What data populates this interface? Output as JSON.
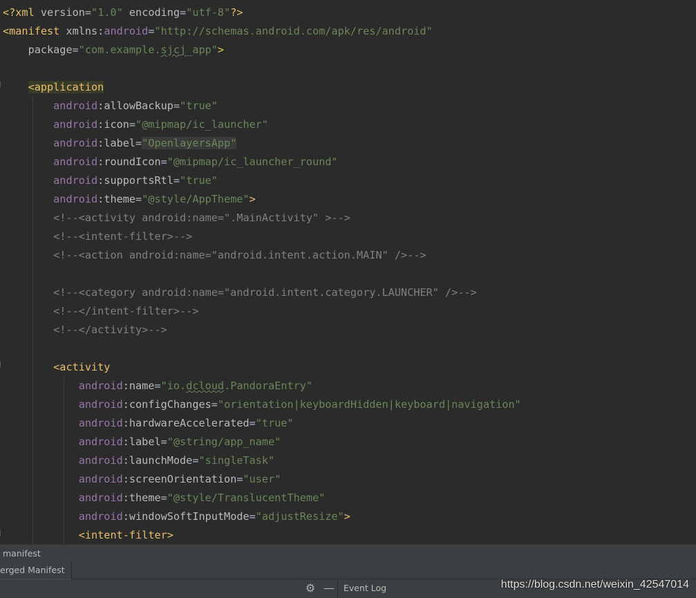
{
  "editor": {
    "lines": [
      [
        [
          "tag",
          "<?xml "
        ],
        [
          "attr",
          "version"
        ],
        [
          "plain",
          "="
        ],
        [
          "str",
          "\"1.0\""
        ],
        [
          "attr",
          " encoding"
        ],
        [
          "plain",
          "="
        ],
        [
          "str",
          "\"utf-8\""
        ],
        [
          "tag",
          "?>"
        ]
      ],
      [
        [
          "tag",
          "<manifest "
        ],
        [
          "attr",
          "xmlns:"
        ],
        [
          "ns",
          "android"
        ],
        [
          "plain",
          "="
        ],
        [
          "str",
          "\"http://schemas.android.com/apk/res/android\""
        ]
      ],
      [
        [
          "plain",
          "    "
        ],
        [
          "attr",
          "package"
        ],
        [
          "plain",
          "="
        ],
        [
          "str",
          "\"com.example."
        ],
        [
          "str-squig",
          "sjcj"
        ],
        [
          "str",
          "_app\""
        ],
        [
          "tag",
          ">"
        ]
      ],
      [],
      [
        [
          "plain",
          "    "
        ],
        [
          "tag-hl",
          "<application"
        ]
      ],
      [
        [
          "plain",
          "        "
        ],
        [
          "ns",
          "android"
        ],
        [
          "attr",
          ":allowBackup"
        ],
        [
          "plain",
          "="
        ],
        [
          "str",
          "\"true\""
        ]
      ],
      [
        [
          "plain",
          "        "
        ],
        [
          "ns",
          "android"
        ],
        [
          "attr",
          ":icon"
        ],
        [
          "plain",
          "="
        ],
        [
          "str",
          "\"@mipmap/ic_launcher\""
        ]
      ],
      [
        [
          "plain",
          "        "
        ],
        [
          "ns",
          "android"
        ],
        [
          "attr",
          ":label"
        ],
        [
          "plain",
          "="
        ],
        [
          "str-hl",
          "\"OpenlayersApp\""
        ]
      ],
      [
        [
          "plain",
          "        "
        ],
        [
          "ns",
          "android"
        ],
        [
          "attr",
          ":roundIcon"
        ],
        [
          "plain",
          "="
        ],
        [
          "str",
          "\"@mipmap/ic_launcher_round\""
        ]
      ],
      [
        [
          "plain",
          "        "
        ],
        [
          "ns",
          "android"
        ],
        [
          "attr",
          ":supportsRtl"
        ],
        [
          "plain",
          "="
        ],
        [
          "str",
          "\"true\""
        ]
      ],
      [
        [
          "plain",
          "        "
        ],
        [
          "ns",
          "android"
        ],
        [
          "attr",
          ":theme"
        ],
        [
          "plain",
          "="
        ],
        [
          "str",
          "\"@style/AppTheme\""
        ],
        [
          "tag",
          ">"
        ]
      ],
      [
        [
          "plain",
          "        "
        ],
        [
          "cm",
          "<!--<activity android:name=\".MainActivity\" >-->"
        ]
      ],
      [
        [
          "plain",
          "        "
        ],
        [
          "cm",
          "<!--<intent-filter>-->"
        ]
      ],
      [
        [
          "plain",
          "        "
        ],
        [
          "cm",
          "<!--<action android:name=\"android.intent.action.MAIN\" />-->"
        ]
      ],
      [],
      [
        [
          "plain",
          "        "
        ],
        [
          "cm",
          "<!--<category android:name=\"android.intent.category.LAUNCHER\" />-->"
        ]
      ],
      [
        [
          "plain",
          "        "
        ],
        [
          "cm",
          "<!--</intent-filter>-->"
        ]
      ],
      [
        [
          "plain",
          "        "
        ],
        [
          "cm",
          "<!--</activity>-->"
        ]
      ],
      [],
      [
        [
          "plain",
          "        "
        ],
        [
          "tag",
          "<activity"
        ]
      ],
      [
        [
          "plain",
          "            "
        ],
        [
          "ns",
          "android"
        ],
        [
          "attr",
          ":name"
        ],
        [
          "plain",
          "="
        ],
        [
          "str",
          "\"io."
        ],
        [
          "str-squig",
          "dcloud"
        ],
        [
          "str",
          ".PandoraEntry\""
        ]
      ],
      [
        [
          "plain",
          "            "
        ],
        [
          "ns",
          "android"
        ],
        [
          "attr",
          ":configChanges"
        ],
        [
          "plain",
          "="
        ],
        [
          "str",
          "\"orientation|keyboardHidden|keyboard|navigation\""
        ]
      ],
      [
        [
          "plain",
          "            "
        ],
        [
          "ns",
          "android"
        ],
        [
          "attr",
          ":hardwareAccelerated"
        ],
        [
          "plain",
          "="
        ],
        [
          "str",
          "\"true\""
        ]
      ],
      [
        [
          "plain",
          "            "
        ],
        [
          "ns",
          "android"
        ],
        [
          "attr",
          ":label"
        ],
        [
          "plain",
          "="
        ],
        [
          "str",
          "\"@string/app_name\""
        ]
      ],
      [
        [
          "plain",
          "            "
        ],
        [
          "ns",
          "android"
        ],
        [
          "attr",
          ":launchMode"
        ],
        [
          "plain",
          "="
        ],
        [
          "str",
          "\"singleTask\""
        ]
      ],
      [
        [
          "plain",
          "            "
        ],
        [
          "ns",
          "android"
        ],
        [
          "attr",
          ":screenOrientation"
        ],
        [
          "plain",
          "="
        ],
        [
          "str",
          "\"user\""
        ]
      ],
      [
        [
          "plain",
          "            "
        ],
        [
          "ns",
          "android"
        ],
        [
          "attr",
          ":theme"
        ],
        [
          "plain",
          "="
        ],
        [
          "str",
          "\"@style/TranslucentTheme\""
        ]
      ],
      [
        [
          "plain",
          "            "
        ],
        [
          "ns",
          "android"
        ],
        [
          "attr",
          ":windowSoftInputMode"
        ],
        [
          "plain",
          "="
        ],
        [
          "str",
          "\"adjustResize\""
        ],
        [
          "tag",
          ">"
        ]
      ],
      [
        [
          "plain",
          "            "
        ],
        [
          "tag",
          "<intent-filter>"
        ]
      ]
    ]
  },
  "breadcrumb": {
    "label": "manifest"
  },
  "tabs": {
    "active_label": "erged Manifest"
  },
  "toolstrip": {
    "gear_icon": "gear-icon",
    "minimize_icon": "minimize-icon",
    "event_log_label": "Event Log"
  },
  "watermark": "https://blog.csdn.net/weixin_42547014",
  "colors": {
    "background": "#2b2b2b",
    "tag": "#e8bf6a",
    "attribute": "#bababa",
    "namespace": "#9876aa",
    "string": "#6a8759",
    "comment": "#808080",
    "panel": "#3c3f41"
  }
}
